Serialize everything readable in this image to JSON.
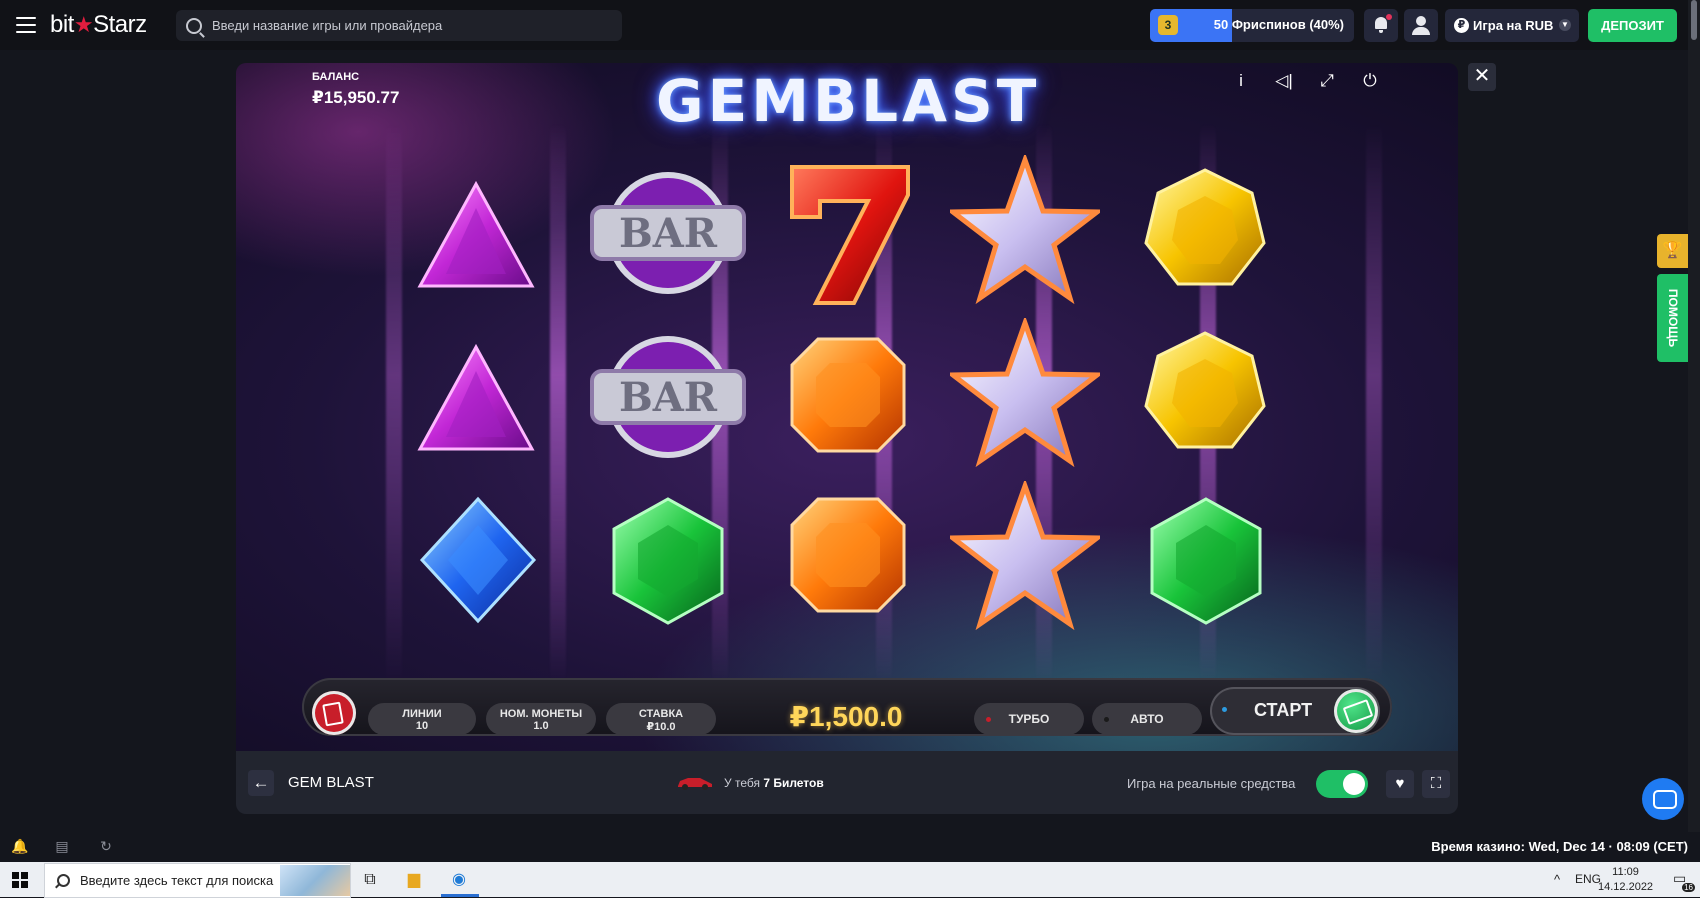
{
  "header": {
    "logo_left": "bit",
    "logo_star": "★",
    "logo_right": "Starz",
    "search_placeholder": "Введи название игры или провайдера",
    "freespins_level": "3",
    "freespins_label": "50 Фриспинов (40%)",
    "freespins_progress": 0.4,
    "currency_label": "Игра на RUB",
    "currency_symbol": "₽",
    "deposit_label": "ДЕПОЗИТ"
  },
  "game": {
    "title": "GEMBLAST",
    "balance_label": "БАЛАНС",
    "balance_value": "₽15,950.77",
    "icons": [
      "info-icon",
      "sound-icon",
      "fullscreen-icon",
      "power-icon"
    ],
    "reels": [
      [
        "purple-triangle",
        "purple-triangle",
        "blue-diamond"
      ],
      [
        "bar",
        "bar",
        "green-hexagon"
      ],
      [
        "red-seven",
        "orange-octagon",
        "orange-octagon"
      ],
      [
        "silver-star",
        "silver-star",
        "silver-star"
      ],
      [
        "yellow-heptagon",
        "yellow-heptagon",
        "green-hexagon"
      ]
    ],
    "controls": {
      "lines_label": "ЛИНИИ",
      "lines_value": "10",
      "coin_label": "НОМ. МОНЕТЫ",
      "coin_value": "1.0",
      "bet_label": "СТАВКА",
      "bet_value": "₽10.0",
      "win_value": "₽1,500.0",
      "turbo_label": "ТУРБО",
      "auto_label": "АВТО",
      "start_label": "СТАРТ"
    }
  },
  "game_footer": {
    "back_glyph": "←",
    "game_name": "GEM BLAST",
    "tickets_prefix": "У тебя",
    "tickets_count": "7 Билетов",
    "real_money_label": "Игра на реальные средства",
    "real_money_on": true
  },
  "side": {
    "help_label": "ПОМОЩЬ"
  },
  "site_footer": {
    "casino_time": "Время казино: Wed, Dec 14 · 08:09 (CET)"
  },
  "taskbar": {
    "search_placeholder": "Введите здесь текст для поиска",
    "lang": "ENG",
    "time": "11:09",
    "date": "14.12.2022",
    "notif_count": "16"
  },
  "colors": {
    "accent_green": "#1fbf66",
    "accent_blue": "#3b74f5",
    "brand_red": "#e21d3e",
    "win_gold": "#ffd65a"
  }
}
